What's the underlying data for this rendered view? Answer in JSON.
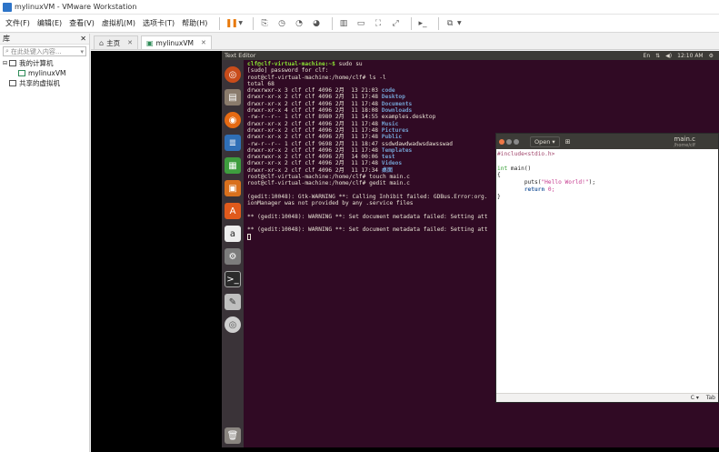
{
  "window": {
    "title": "mylinuxVM - VMware Workstation"
  },
  "menu": [
    "文件(F)",
    "编辑(E)",
    "查看(V)",
    "虚拟机(M)",
    "选项卡(T)",
    "帮助(H)"
  ],
  "library": {
    "title": "库",
    "close": "✕",
    "search_placeholder": "在此处键入内容...",
    "items": [
      {
        "label": "我的计算机",
        "level": 0
      },
      {
        "label": "mylinuxVM",
        "level": 1
      },
      {
        "label": "共享的虚拟机",
        "level": 0
      }
    ]
  },
  "tabs": [
    {
      "label": "主页",
      "icon": "home-icon",
      "active": false
    },
    {
      "label": "mylinuxVM",
      "icon": "vm-icon",
      "active": true
    }
  ],
  "guest": {
    "top_title": "Text Editor",
    "clock": "12:10 AM",
    "indicators": [
      "En",
      "⇅",
      "◀)",
      "⚙"
    ]
  },
  "terminal": {
    "lines": [
      {
        "prompt": "clf@clf-virtual-machine:~$",
        "text": " sudo su"
      },
      {
        "text": "[sudo] password for clf:"
      },
      {
        "text": "root@clf-virtual-machine:/home/clf# ls -l"
      },
      {
        "text": "total 68"
      },
      {
        "text": "drwxrwxr-x 3 clf clf 4096 2月  13 21:03 ",
        "dir": "code"
      },
      {
        "text": "drwxr-xr-x 2 clf clf 4096 2月  11 17:48 ",
        "dir": "Desktop"
      },
      {
        "text": "drwxr-xr-x 2 clf clf 4096 2月  11 17:48 ",
        "dir": "Documents"
      },
      {
        "text": "drwxr-xr-x 4 clf clf 4096 2月  11 18:08 ",
        "dir": "Downloads"
      },
      {
        "text": "-rw-r--r-- 1 clf clf 8980 2月  11 14:55 examples.desktop"
      },
      {
        "text": "drwxr-xr-x 2 clf clf 4096 2月  11 17:48 ",
        "dir": "Music"
      },
      {
        "text": "drwxr-xr-x 2 clf clf 4096 2月  11 17:48 ",
        "dir": "Pictures"
      },
      {
        "text": "drwxr-xr-x 2 clf clf 4096 2月  11 17:48 ",
        "dir": "Public"
      },
      {
        "text": "-rw-r--r-- 1 clf clf 9698 2月  11 18:47 ssdwdawdwadwsdawsswad"
      },
      {
        "text": "drwxr-xr-x 2 clf clf 4096 2月  11 17:48 ",
        "dir": "Templates"
      },
      {
        "text": "drwxrwxr-x 2 clf clf 4096 2月  14 00:06 ",
        "dir": "test"
      },
      {
        "text": "drwxr-xr-x 2 clf clf 4096 2月  11 17:48 ",
        "dir": "Videos"
      },
      {
        "text": "drwxr-xr-x 2 clf clf 4096 2月  11 17:34 ",
        "dir": "桌面"
      },
      {
        "text": "root@clf-virtual-machine:/home/clf# touch main.c"
      },
      {
        "text": "root@clf-virtual-machine:/home/clf# gedit main.c"
      },
      {
        "text": ""
      },
      {
        "text": "(gedit:10048): Gtk-WARNING **: Calling Inhibit failed: GDBus.Error:org."
      },
      {
        "text": "ionManager was not provided by any .service files"
      },
      {
        "text": ""
      },
      {
        "text": "** (gedit:10048): WARNING **: Set document metadata failed: Setting att"
      },
      {
        "text": ""
      },
      {
        "text": "** (gedit:10048): WARNING **: Set document metadata failed: Setting att"
      },
      {
        "cursor": true
      }
    ]
  },
  "gedit": {
    "open_label": "Open ▾",
    "filename": "main.c",
    "path": "/home/clf",
    "code": {
      "include": "#include<stdio.h>",
      "sig_type": "int",
      "sig_rest": " main()",
      "open_brace": "{",
      "puts": "puts(",
      "string": "\"Hello World!\"",
      "puts_end": ");",
      "return_kw": "return",
      "return_val": " 0;",
      "close_brace": "}"
    },
    "status": {
      "lang": "C ▾",
      "tab": "Tab"
    }
  }
}
